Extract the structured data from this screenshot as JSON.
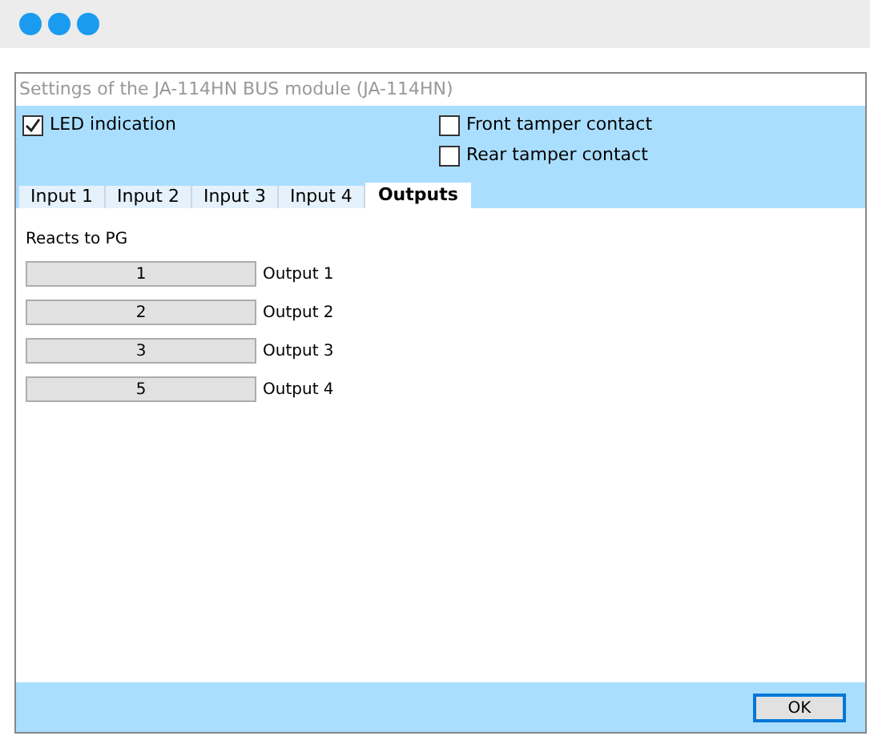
{
  "window": {
    "title": "Settings of the JA-114HN BUS module (JA-114HN)"
  },
  "options_left": [
    {
      "label": "LED indication",
      "checked": true
    }
  ],
  "options_right": [
    {
      "label": "Front tamper contact",
      "checked": false
    },
    {
      "label": "Rear tamper contact",
      "checked": false
    }
  ],
  "tabs": [
    {
      "label": "Input 1",
      "selected": false
    },
    {
      "label": "Input 2",
      "selected": false
    },
    {
      "label": "Input 3",
      "selected": false
    },
    {
      "label": "Input 4",
      "selected": false
    },
    {
      "label": "Outputs",
      "selected": true
    }
  ],
  "section_label": "Reacts to PG",
  "outputs": [
    {
      "value": "1",
      "label": "Output 1"
    },
    {
      "value": "2",
      "label": "Output 2"
    },
    {
      "value": "3",
      "label": "Output 3"
    },
    {
      "value": "5",
      "label": "Output 4"
    }
  ],
  "buttons": [
    "OK"
  ]
}
